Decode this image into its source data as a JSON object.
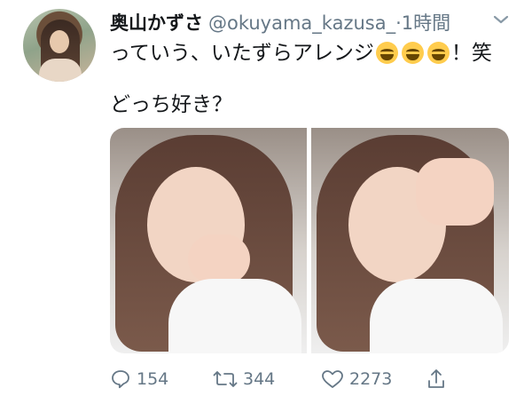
{
  "tweet": {
    "author_name": "奥山かずさ",
    "handle": "@okuyama_kazusa_",
    "time": "·1時間",
    "text_before_emoji": "っていう、いたずらアレンジ",
    "text_after_emoji": "！笑",
    "line2": "どっち好き？",
    "emoji_count": 3
  },
  "actions": {
    "reply_count": "154",
    "retweet_count": "344",
    "like_count": "2273"
  },
  "colors": {
    "primary_text": "#14171a",
    "secondary_text": "#657786",
    "background": "#ffffff"
  },
  "icons": [
    "chevron-down-icon",
    "face-with-tears-of-joy-icon",
    "reply-icon",
    "retweet-icon",
    "like-icon",
    "share-icon"
  ]
}
